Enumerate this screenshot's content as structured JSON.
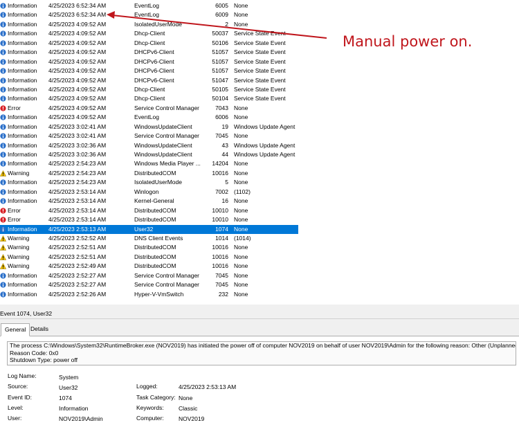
{
  "events": [
    {
      "level": "Information",
      "date": "4/25/2023 6:52:34 AM",
      "source": "EventLog",
      "id": "6005",
      "task": "None"
    },
    {
      "level": "Information",
      "date": "4/25/2023 6:52:34 AM",
      "source": "EventLog",
      "id": "6009",
      "task": "None"
    },
    {
      "level": "Information",
      "date": "4/25/2023 4:09:52 AM",
      "source": "IsolatedUserMode",
      "id": "2",
      "task": "None"
    },
    {
      "level": "Information",
      "date": "4/25/2023 4:09:52 AM",
      "source": "Dhcp-Client",
      "id": "50037",
      "task": "Service State Event"
    },
    {
      "level": "Information",
      "date": "4/25/2023 4:09:52 AM",
      "source": "Dhcp-Client",
      "id": "50106",
      "task": "Service State Event"
    },
    {
      "level": "Information",
      "date": "4/25/2023 4:09:52 AM",
      "source": "DHCPv6-Client",
      "id": "51057",
      "task": "Service State Event"
    },
    {
      "level": "Information",
      "date": "4/25/2023 4:09:52 AM",
      "source": "DHCPv6-Client",
      "id": "51057",
      "task": "Service State Event"
    },
    {
      "level": "Information",
      "date": "4/25/2023 4:09:52 AM",
      "source": "DHCPv6-Client",
      "id": "51057",
      "task": "Service State Event"
    },
    {
      "level": "Information",
      "date": "4/25/2023 4:09:52 AM",
      "source": "DHCPv6-Client",
      "id": "51047",
      "task": "Service State Event"
    },
    {
      "level": "Information",
      "date": "4/25/2023 4:09:52 AM",
      "source": "Dhcp-Client",
      "id": "50105",
      "task": "Service State Event"
    },
    {
      "level": "Information",
      "date": "4/25/2023 4:09:52 AM",
      "source": "Dhcp-Client",
      "id": "50104",
      "task": "Service State Event"
    },
    {
      "level": "Error",
      "date": "4/25/2023 4:09:52 AM",
      "source": "Service Control Manager",
      "id": "7043",
      "task": "None"
    },
    {
      "level": "Information",
      "date": "4/25/2023 4:09:52 AM",
      "source": "EventLog",
      "id": "6006",
      "task": "None"
    },
    {
      "level": "Information",
      "date": "4/25/2023 3:02:41 AM",
      "source": "WindowsUpdateClient",
      "id": "19",
      "task": "Windows Update Agent"
    },
    {
      "level": "Information",
      "date": "4/25/2023 3:02:41 AM",
      "source": "Service Control Manager",
      "id": "7045",
      "task": "None"
    },
    {
      "level": "Information",
      "date": "4/25/2023 3:02:36 AM",
      "source": "WindowsUpdateClient",
      "id": "43",
      "task": "Windows Update Agent"
    },
    {
      "level": "Information",
      "date": "4/25/2023 3:02:36 AM",
      "source": "WindowsUpdateClient",
      "id": "44",
      "task": "Windows Update Agent"
    },
    {
      "level": "Information",
      "date": "4/25/2023 2:54:23 AM",
      "source": "Windows Media Player ...",
      "id": "14204",
      "task": "None"
    },
    {
      "level": "Warning",
      "date": "4/25/2023 2:54:23 AM",
      "source": "DistributedCOM",
      "id": "10016",
      "task": "None"
    },
    {
      "level": "Information",
      "date": "4/25/2023 2:54:23 AM",
      "source": "IsolatedUserMode",
      "id": "5",
      "task": "None"
    },
    {
      "level": "Information",
      "date": "4/25/2023 2:53:14 AM",
      "source": "Winlogon",
      "id": "7002",
      "task": "(1102)"
    },
    {
      "level": "Information",
      "date": "4/25/2023 2:53:14 AM",
      "source": "Kernel-General",
      "id": "16",
      "task": "None"
    },
    {
      "level": "Error",
      "date": "4/25/2023 2:53:14 AM",
      "source": "DistributedCOM",
      "id": "10010",
      "task": "None"
    },
    {
      "level": "Error",
      "date": "4/25/2023 2:53:14 AM",
      "source": "DistributedCOM",
      "id": "10010",
      "task": "None"
    },
    {
      "level": "Information",
      "date": "4/25/2023 2:53:13 AM",
      "source": "User32",
      "id": "1074",
      "task": "None",
      "selected": true
    },
    {
      "level": "Warning",
      "date": "4/25/2023 2:52:52 AM",
      "source": "DNS Client Events",
      "id": "1014",
      "task": "(1014)"
    },
    {
      "level": "Warning",
      "date": "4/25/2023 2:52:51 AM",
      "source": "DistributedCOM",
      "id": "10016",
      "task": "None"
    },
    {
      "level": "Warning",
      "date": "4/25/2023 2:52:51 AM",
      "source": "DistributedCOM",
      "id": "10016",
      "task": "None"
    },
    {
      "level": "Warning",
      "date": "4/25/2023 2:52:49 AM",
      "source": "DistributedCOM",
      "id": "10016",
      "task": "None"
    },
    {
      "level": "Information",
      "date": "4/25/2023 2:52:27 AM",
      "source": "Service Control Manager",
      "id": "7045",
      "task": "None"
    },
    {
      "level": "Information",
      "date": "4/25/2023 2:52:27 AM",
      "source": "Service Control Manager",
      "id": "7045",
      "task": "None"
    },
    {
      "level": "Information",
      "date": "4/25/2023 2:52:26 AM",
      "source": "Hyper-V-VmSwitch",
      "id": "232",
      "task": "None"
    }
  ],
  "annotation": {
    "text": "Manual power on.",
    "color": "#c0161c"
  },
  "detail": {
    "header": "Event 1074, User32",
    "tabs": {
      "general": "General",
      "details": "Details"
    },
    "message": [
      "The process C:\\Windows\\System32\\RuntimeBroker.exe (NOV2019) has initiated the power off of computer NOV2019 on behalf of user NOV2019\\Admin for the following reason: Other (Unplanned)",
      "Reason Code: 0x0",
      "Shutdown Type: power off"
    ],
    "props": {
      "log_name_label": "Log Name:",
      "log_name": "System",
      "source_label": "Source:",
      "source": "User32",
      "logged_label": "Logged:",
      "logged": "4/25/2023 2:53:13 AM",
      "event_id_label": "Event ID:",
      "event_id": "1074",
      "task_label": "Task Category:",
      "task": "None",
      "level_label": "Level:",
      "level": "Information",
      "keywords_label": "Keywords:",
      "keywords": "Classic",
      "user_label": "User:",
      "user": "NOV2019\\Admin",
      "computer_label": "Computer:",
      "computer": "NOV2019"
    }
  },
  "colors": {
    "selection": "#0078d7",
    "info_icon": "#2a6fc9",
    "error_icon": "#d81e24",
    "warning_icon": "#f2c200"
  },
  "icons": {
    "Information": "information-icon",
    "Error": "error-icon",
    "Warning": "warning-icon"
  }
}
